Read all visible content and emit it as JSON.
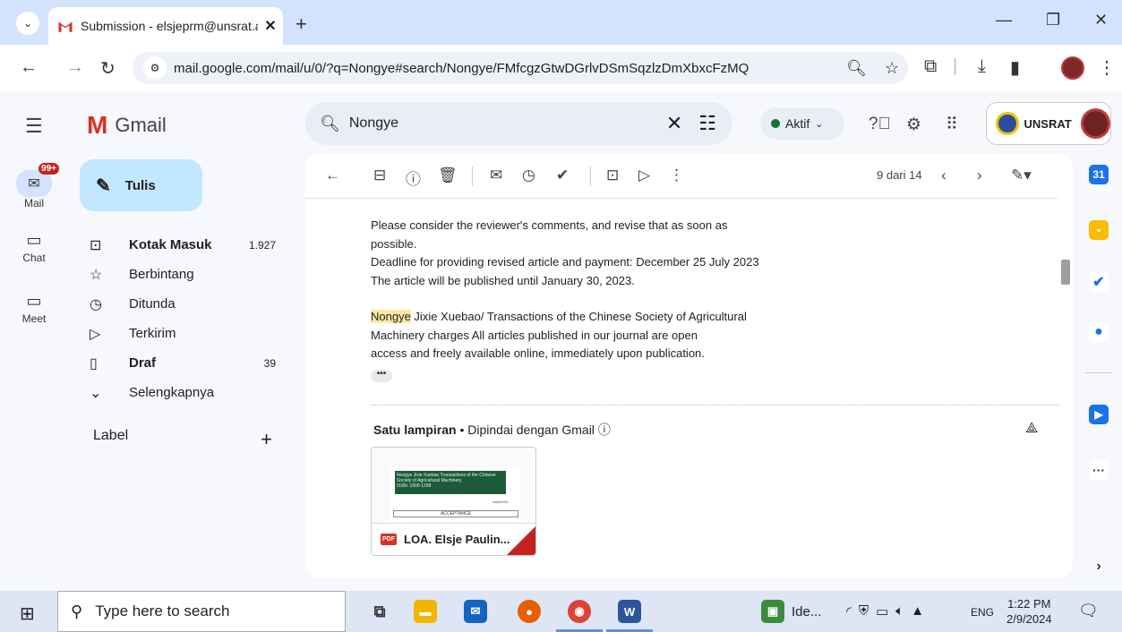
{
  "browser": {
    "tab_title": "Submission - elsjeprm@unsrat.a",
    "new_tab_label": "+",
    "url": "mail.google.com/mail/u/0/?q=Nongye#search/Nongye/FMfcgzGtwDGrlvDSmSqzlzDmXbxcFzMQ"
  },
  "gmail": {
    "product_name": "Gmail",
    "search_query": "Nongye",
    "status_label": "Aktif",
    "org_name": "UNSRAT",
    "colors": {
      "accent": "#c2e7ff",
      "brand_red": "#d93025",
      "badge": "#c5221f"
    }
  },
  "rail": {
    "mail_label": "Mail",
    "mail_badge": "99+",
    "chat_label": "Chat",
    "meet_label": "Meet"
  },
  "compose_label": "Tulis",
  "nav": [
    {
      "label": "Kotak Masuk",
      "count": "1.927",
      "bold": true,
      "icon": "inbox-icon"
    },
    {
      "label": "Berbintang",
      "count": "",
      "bold": false,
      "icon": "star-icon"
    },
    {
      "label": "Ditunda",
      "count": "",
      "bold": false,
      "icon": "clock-icon"
    },
    {
      "label": "Terkirim",
      "count": "",
      "bold": false,
      "icon": "send-icon"
    },
    {
      "label": "Draf",
      "count": "39",
      "bold": true,
      "icon": "draft-icon"
    },
    {
      "label": "Selengkapnya",
      "count": "",
      "bold": false,
      "icon": "chevron-down-icon"
    }
  ],
  "labels_heading": "Label",
  "message": {
    "pager": "9 dari 14",
    "lines_1": [
      "Please consider the reviewer's comments, and revise that as soon as",
      "possible.",
      "Deadline for providing revised article and payment: December 25 July  2023",
      "The article will be published until January 30, 2023."
    ],
    "highlight_word": "Nongye",
    "para2_first_rest": " Jixie Xuebao/ Transactions of the Chinese Society of Agricultural",
    "lines_2": [
      "Machinery charges  All articles published in our journal are open",
      "access and freely available online, immediately upon publication."
    ],
    "attachments_heading": "Satu lampiran",
    "attachments_scan": "Dipindai dengan Gmail",
    "attachment": {
      "file_label": "LOA. Elsje Paulin...",
      "file_type": "PDF",
      "thumb_title": "Nongye Jixie Xuebao Transactions of the Chinese Society of Agricultural Machinery",
      "thumb_issn": "ISSN: 1000-1298",
      "thumb_date": "July/2023",
      "thumb_accept": "ACCEPTANCE"
    }
  },
  "taskbar": {
    "search_placeholder": "Type here to search",
    "app_label": "Ide...",
    "lang": "ENG",
    "time": "1:22 PM",
    "date": "2/9/2024"
  }
}
